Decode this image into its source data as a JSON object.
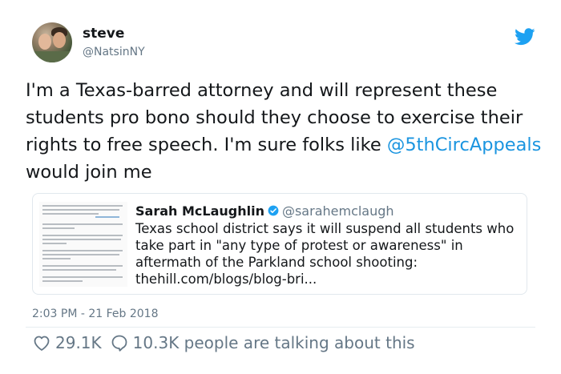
{
  "author": {
    "name": "steve",
    "handle": "@NatsinNY"
  },
  "tweet": {
    "text_before": "I'm a Texas-barred attorney and will represent these students pro bono should they choose to exercise their rights to free speech.  I'm sure folks like ",
    "mention": "@5thCircAppeals",
    "text_after": " would join me",
    "timestamp": "2:03 PM - 21 Feb 2018"
  },
  "quoted_tweet": {
    "name": "Sarah McLaughlin",
    "handle": "@sarahemclaugh",
    "text": "Texas school district says it will suspend all students who take part in \"any type of protest or awareness\" in aftermath of the Parkland school shooting: thehill.com/blogs/blog-bri..."
  },
  "engagement": {
    "likes": "29.1K",
    "replies_text": "10.3K people are talking about this"
  },
  "colors": {
    "link": "#1b95e0",
    "secondary_text": "#657786",
    "twitter_blue": "#1da1f2"
  },
  "icons": [
    "twitter-bird-icon",
    "verified-badge-icon",
    "heart-icon",
    "comment-icon"
  ]
}
